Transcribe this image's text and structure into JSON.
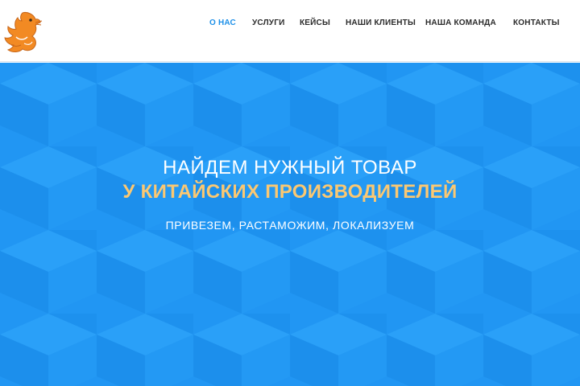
{
  "nav": {
    "items": [
      {
        "label": "О НАС",
        "active": true
      },
      {
        "label": "УСЛУГИ",
        "active": false
      },
      {
        "label": "КЕЙСЫ",
        "active": false
      },
      {
        "label": "НАШИ КЛИЕНТЫ",
        "active": false
      },
      {
        "label": "НАША КОМАНДА",
        "active": false
      },
      {
        "label": "КОНТАКТЫ",
        "active": false
      }
    ]
  },
  "logo": {
    "icon": "dragon-logo-icon",
    "color": "#f28a23"
  },
  "hero": {
    "title": "НАЙДЕМ НУЖНЫЙ ТОВАР",
    "subtitle": "У КИТАЙСКИХ ПРОИЗВОДИТЕЛЕЙ",
    "tagline": "ПРИВЕЗЕМ, РАСТАМОЖИМ, ЛОКАЛИЗУЕМ"
  },
  "colors": {
    "accent": "#1e90e8",
    "hero_background": "#2196f3",
    "highlight": "#fbc872"
  }
}
